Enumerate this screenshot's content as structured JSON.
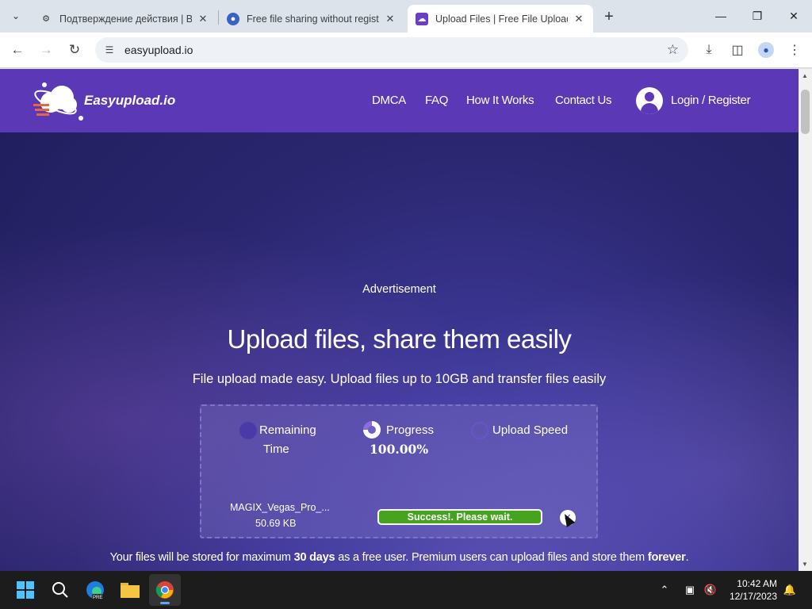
{
  "browser": {
    "tabs": [
      {
        "title": "Подтверждение действия | BL",
        "favicon": "tool-favicon-icon",
        "active": false
      },
      {
        "title": "Free file sharing without registr",
        "favicon": "globe-favicon-icon",
        "active": false
      },
      {
        "title": "Upload Files | Free File Upload",
        "favicon": "easyupload-favicon-icon",
        "active": true
      }
    ],
    "url": "easyupload.io"
  },
  "site": {
    "logo_text": "Easyupload.io",
    "nav": [
      "DMCA",
      "FAQ",
      "How It Works",
      "Contact Us"
    ],
    "login_label": "Login / Register",
    "brand_color": "#5b38b6"
  },
  "main": {
    "ad_label": "Advertisement",
    "title": "Upload files, share them easily",
    "subtitle": "File upload made easy. Upload files up to 10GB and transfer files easily",
    "stats": {
      "remaining_label_1": "Remaining",
      "remaining_label_2": "Time",
      "progress_label": "Progress",
      "progress_value": "100.00%",
      "speed_label": "Upload Speed"
    },
    "file": {
      "name": "MAGIX_Vegas_Pro_...",
      "size": "50.69 KB",
      "status": "Success!. Please wait.",
      "progress_fraction": 1.0
    },
    "storage_note": {
      "part1": "Your files will be stored for maximum ",
      "bold1": "30 days",
      "part2": " as a free user. Premium users can upload files and store them ",
      "bold2": "forever",
      "part3": "."
    }
  },
  "taskbar": {
    "time": "10:42 AM",
    "date": "12/17/2023",
    "apps": [
      "start-icon",
      "search-icon",
      "edge-icon",
      "file-explorer-icon",
      "chrome-icon"
    ]
  }
}
